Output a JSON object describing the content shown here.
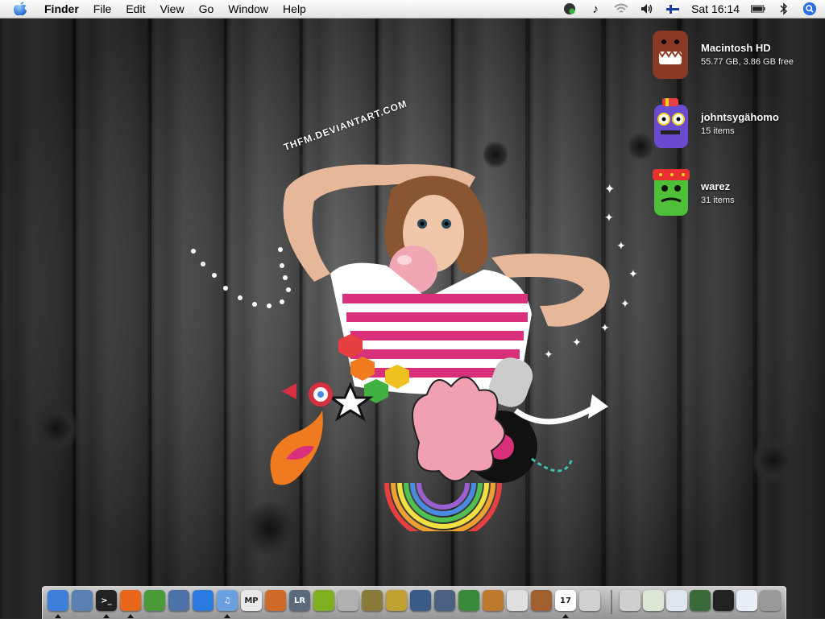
{
  "menubar": {
    "app_name": "Finder",
    "menus": [
      "File",
      "Edit",
      "View",
      "Go",
      "Window",
      "Help"
    ],
    "clock": "Sat 16:14",
    "status_icons": [
      "chat-status-icon",
      "music-note-icon",
      "wifi-icon",
      "volume-icon",
      "finland-flag-icon",
      "battery-icon",
      "bluetooth-icon",
      "spotlight-icon"
    ]
  },
  "desktop_icons": [
    {
      "name": "Macintosh HD",
      "info": "55.77 GB, 3.86 GB free",
      "color": "#8a3a22"
    },
    {
      "name": "johntsygähomo",
      "info": "15 items",
      "color": "#6a4bd0"
    },
    {
      "name": "warez",
      "info": "31 items",
      "color": "#4fbf3a"
    }
  ],
  "wallpaper": {
    "watermark": "THFM.DEVIANTART.COM"
  },
  "dock": {
    "apps": [
      {
        "name": "finder-icon",
        "color": "#3b7fd8",
        "label": ""
      },
      {
        "name": "preview-icon",
        "color": "#5a7fb0",
        "label": ""
      },
      {
        "name": "terminal-icon",
        "color": "#222222",
        "label": ">_"
      },
      {
        "name": "firefox-icon",
        "color": "#e8671a",
        "label": ""
      },
      {
        "name": "adium-icon",
        "color": "#4a9a3a",
        "label": ""
      },
      {
        "name": "network-globe-icon",
        "color": "#4c72a8",
        "label": ""
      },
      {
        "name": "sync-icon",
        "color": "#2a7ae0",
        "label": ""
      },
      {
        "name": "itunes-icon",
        "color": "#6aa0e0",
        "label": "♫"
      },
      {
        "name": "mplayer-icon",
        "color": "#e8e8e8",
        "label": "MP"
      },
      {
        "name": "photo-editor-icon",
        "color": "#d06a2a",
        "label": ""
      },
      {
        "name": "lightroom-icon",
        "color": "#5a6a7a",
        "label": "LR"
      },
      {
        "name": "chip-icon",
        "color": "#7fb020",
        "label": ""
      },
      {
        "name": "calendar-alarm-icon",
        "color": "#b0b0b0",
        "label": ""
      },
      {
        "name": "shield-icon",
        "color": "#8a7a3a",
        "label": ""
      },
      {
        "name": "tools-icon",
        "color": "#c0a030",
        "label": ""
      },
      {
        "name": "dashboard-icon",
        "color": "#3a5a8a",
        "label": ""
      },
      {
        "name": "pen-tool-icon",
        "color": "#4a6080",
        "label": ""
      },
      {
        "name": "chart-icon",
        "color": "#3a8a3a",
        "label": ""
      },
      {
        "name": "slideshow-icon",
        "color": "#c07a30",
        "label": ""
      },
      {
        "name": "text-edit-icon",
        "color": "#e0e0e0",
        "label": ""
      },
      {
        "name": "photo-album-icon",
        "color": "#a06030",
        "label": ""
      },
      {
        "name": "ical-icon",
        "color": "#ffffff",
        "label": "17"
      },
      {
        "name": "apple-pref-icon",
        "color": "#d0d0d0",
        "label": ""
      }
    ],
    "docked_windows": [
      {
        "name": "mail-icon",
        "color": "#cfcfcf"
      },
      {
        "name": "window-thumb-1",
        "color": "#dbe6d4"
      },
      {
        "name": "window-thumb-2",
        "color": "#dfe6ee"
      },
      {
        "name": "window-thumb-3",
        "color": "#3a6a3a"
      },
      {
        "name": "window-thumb-4",
        "color": "#222222"
      },
      {
        "name": "window-thumb-5",
        "color": "#e8eef5"
      },
      {
        "name": "trash-icon",
        "color": "#9a9a9a"
      }
    ]
  }
}
